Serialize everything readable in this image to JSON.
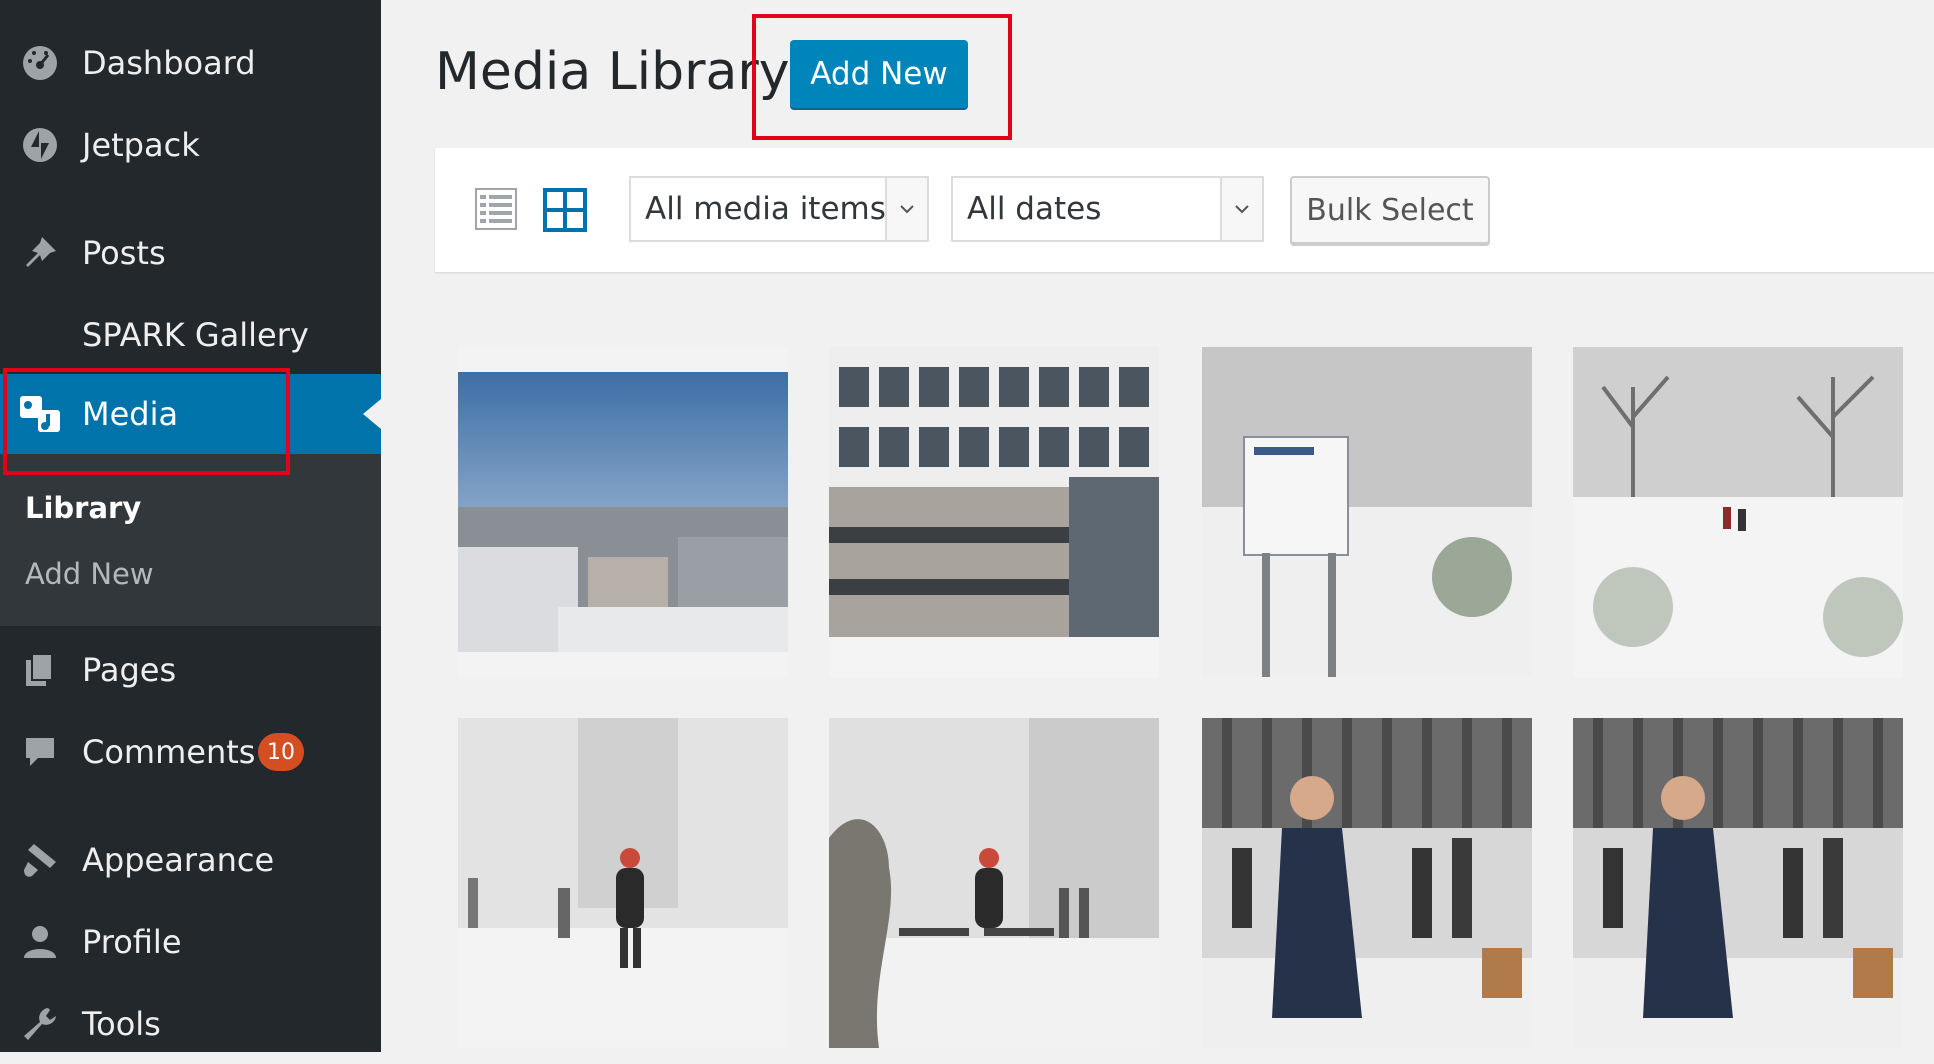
{
  "sidebar": {
    "items": [
      {
        "label": "Dashboard",
        "icon": "dashboard-icon"
      },
      {
        "label": "Jetpack",
        "icon": "jetpack-icon"
      },
      {
        "label": "Posts",
        "icon": "pin-icon"
      },
      {
        "label": "SPARK Gallery",
        "icon": ""
      },
      {
        "label": "Media",
        "icon": "media-icon"
      },
      {
        "label": "Pages",
        "icon": "pages-icon"
      },
      {
        "label": "Comments",
        "icon": "comments-icon",
        "badge": "10"
      },
      {
        "label": "Appearance",
        "icon": "brush-icon"
      },
      {
        "label": "Profile",
        "icon": "user-icon"
      },
      {
        "label": "Tools",
        "icon": "wrench-icon"
      }
    ],
    "submenu": [
      "Library",
      "Add New"
    ]
  },
  "main": {
    "title": "Media Library",
    "add_new_label": "Add New",
    "toolbar": {
      "filter_type": "All media items",
      "filter_date": "All dates",
      "bulk_select": "Bulk Select"
    },
    "tiles": [
      {
        "subject": "city rooftops under blue sky"
      },
      {
        "subject": "modern building facade"
      },
      {
        "subject": "Imperial College sign in snow"
      },
      {
        "subject": "snowy park with people"
      },
      {
        "subject": "person in snowstorm"
      },
      {
        "subject": "people by benches in snow"
      },
      {
        "subject": "woman in coat in snow crowd"
      },
      {
        "subject": "woman in coat in snow crowd"
      }
    ]
  },
  "colors": {
    "sidebar_bg": "#23282d",
    "active_bg": "#0073aa",
    "accent_button": "#0085ba",
    "annotation_red": "#e2001a",
    "badge": "#d54e21"
  }
}
